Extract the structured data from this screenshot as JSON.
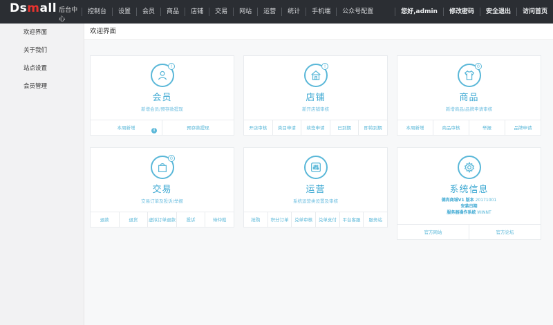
{
  "logo": {
    "main_prefix": "Ds",
    "main_red": "m",
    "main_suffix": "all",
    "sub": "后台中心"
  },
  "nav": {
    "items": [
      "控制台",
      "设置",
      "会员",
      "商品",
      "店铺",
      "交易",
      "网站",
      "运营",
      "统计",
      "手机端",
      "公众号配置"
    ],
    "right": [
      "您好,admin",
      "修改密码",
      "安全退出",
      "访问首页"
    ]
  },
  "sidebar": {
    "items": [
      "欢迎界面",
      "关于我们",
      "站点设置",
      "会员管理"
    ]
  },
  "main": {
    "title": "欢迎界面"
  },
  "cards": [
    {
      "title": "会员",
      "desc": "新增会员/预存款提现",
      "badge": "!",
      "icon": "user-icon",
      "links": [
        "本周新增",
        "预存款提现"
      ]
    },
    {
      "title": "店铺",
      "desc": "新开店铺审核",
      "badge": "!",
      "icon": "store-icon",
      "links": [
        "开店审核",
        "类目申请",
        "续签申请",
        "已到期",
        "即将到期"
      ]
    },
    {
      "title": "商品",
      "desc": "新增商品/品牌申请审核",
      "badge": "0",
      "icon": "tshirt-icon",
      "links": [
        "本周新增",
        "商品审核",
        "举报",
        "品牌申请"
      ]
    },
    {
      "title": "交易",
      "desc": "交易订单及投诉/举报",
      "badge": "0",
      "icon": "bag-icon",
      "links": [
        "退款",
        "退货",
        "虚拟订单退款",
        "投诉",
        "待仲裁"
      ]
    },
    {
      "title": "运营",
      "desc": "系统运营类设置及审核",
      "badge": "",
      "icon": "sliders-icon",
      "links": [
        "抢购",
        "积分订单",
        "兑单审核",
        "兑单支付",
        "平台客服",
        "服务站"
      ]
    },
    {
      "title": "系统信息",
      "icon": "gear-icon",
      "info": {
        "line1_label": "德尚商城V1 版本",
        "line1_value": "20171001",
        "line2": "安装日期",
        "line3_label": "服务器操作系统",
        "line3_value": "WINNT"
      },
      "links": [
        "官方网站",
        "官方论坛"
      ]
    }
  ],
  "info_dot": "i",
  "colors": {
    "topbar": "#2b2e33",
    "accent": "#59b7d8",
    "logo_red": "#e9332f"
  }
}
